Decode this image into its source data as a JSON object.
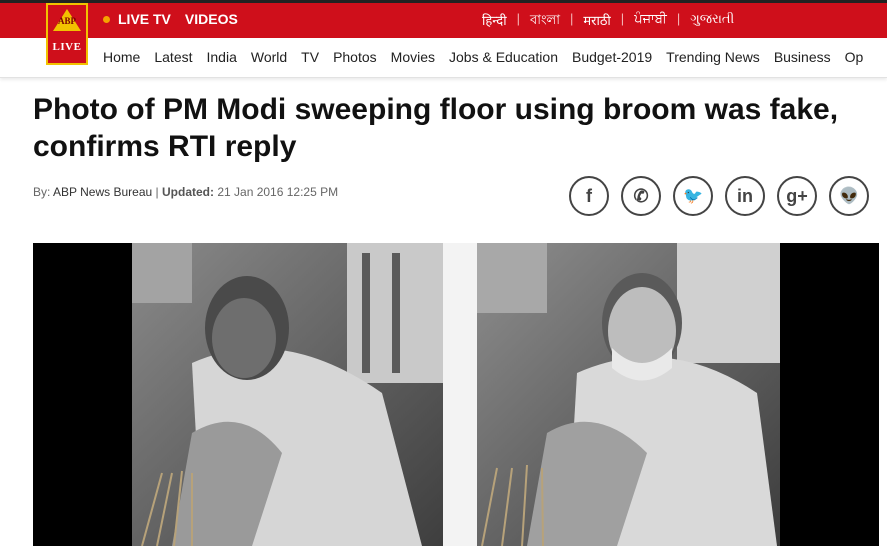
{
  "logo": {
    "top": "ABP",
    "bottom": "LIVE"
  },
  "topbar": {
    "live_tv": "LIVE TV",
    "videos": "VIDEOS",
    "languages": [
      "हिन्दी",
      "বাংলা",
      "मराठी",
      "ਪੰਜਾਬੀ",
      "ગુજરાતી"
    ]
  },
  "nav": [
    "Home",
    "Latest",
    "India",
    "World",
    "TV",
    "Photos",
    "Movies",
    "Jobs & Education",
    "Budget-2019",
    "Trending News",
    "Business",
    "Op"
  ],
  "article": {
    "headline": "Photo of PM Modi sweeping floor using broom was fake, confirms RTI reply",
    "by_label": "By:",
    "author": "ABP News Bureau",
    "updated_label": "Updated:",
    "updated_value": "21 Jan 2016 12:25 PM"
  },
  "share": [
    {
      "icon": "facebook-icon",
      "glyph": "f"
    },
    {
      "icon": "whatsapp-icon",
      "glyph": "✆"
    },
    {
      "icon": "twitter-icon",
      "glyph": "🐦"
    },
    {
      "icon": "linkedin-icon",
      "glyph": "in"
    },
    {
      "icon": "google-plus-icon",
      "glyph": "g+"
    },
    {
      "icon": "reddit-icon",
      "glyph": "👽"
    }
  ],
  "colors": {
    "brand_red": "#cf0f1b",
    "accent_yellow": "#f2c200",
    "live_dot": "#f5a300"
  }
}
